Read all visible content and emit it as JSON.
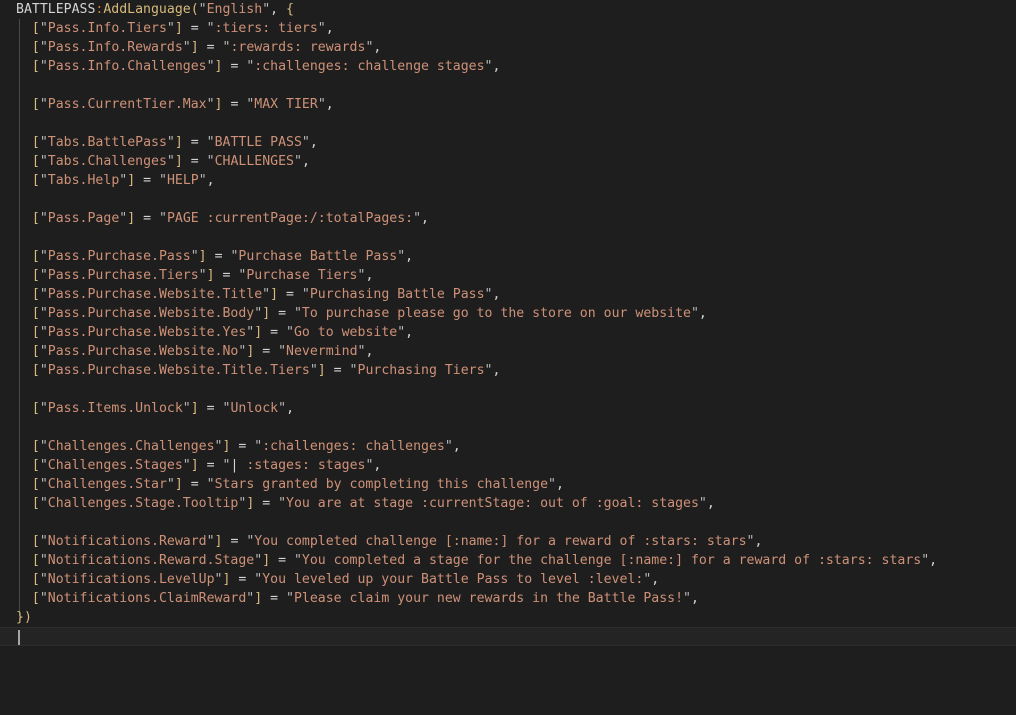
{
  "editor": {
    "kind": "code-editor",
    "language": "lua",
    "background_color": "#1e1e1e",
    "default_text_color": "#d4d4d4",
    "caret_color": "#a6a6a6",
    "current_line_background": "#242424",
    "indent_guide_color": "#4a4a4a",
    "palette": {
      "identifier": "#d4d4d4",
      "method_separator": "#cc7832",
      "function_name": "#d7ba7d",
      "bracket": "#d7ba7d",
      "quote": "#b9b9b9",
      "string": "#ce9178",
      "operator": "#d4d4d4",
      "punctuation": "#d4d4d4"
    }
  },
  "code": {
    "header": {
      "object": "BATTLEPASS",
      "separator": ":",
      "method": "AddLanguage",
      "open_paren": "(",
      "arg_quote": "\"",
      "arg": "English",
      "comma": ",",
      "open_brace": "{"
    },
    "footer": {
      "close": "})"
    },
    "caret_line_text": "",
    "groups": [
      {
        "name": "pass-info",
        "entries": [
          {
            "key": "Pass.Info.Tiers",
            "value": ":tiers: tiers"
          },
          {
            "key": "Pass.Info.Rewards",
            "value": ":rewards: rewards"
          },
          {
            "key": "Pass.Info.Challenges",
            "value": ":challenges: challenge stages"
          }
        ]
      },
      {
        "name": "current-tier",
        "entries": [
          {
            "key": "Pass.CurrentTier.Max",
            "value": "MAX TIER"
          }
        ]
      },
      {
        "name": "tabs",
        "entries": [
          {
            "key": "Tabs.BattlePass",
            "value": "BATTLE PASS"
          },
          {
            "key": "Tabs.Challenges",
            "value": "CHALLENGES"
          },
          {
            "key": "Tabs.Help",
            "value": "HELP"
          }
        ]
      },
      {
        "name": "page",
        "entries": [
          {
            "key": "Pass.Page",
            "value": "PAGE :currentPage:/:totalPages:"
          }
        ]
      },
      {
        "name": "purchase",
        "entries": [
          {
            "key": "Pass.Purchase.Pass",
            "value": "Purchase Battle Pass"
          },
          {
            "key": "Pass.Purchase.Tiers",
            "value": "Purchase Tiers"
          },
          {
            "key": "Pass.Purchase.Website.Title",
            "value": "Purchasing Battle Pass"
          },
          {
            "key": "Pass.Purchase.Website.Body",
            "value": "To purchase please go to the store on our website"
          },
          {
            "key": "Pass.Purchase.Website.Yes",
            "value": "Go to website"
          },
          {
            "key": "Pass.Purchase.Website.No",
            "value": "Nevermind"
          },
          {
            "key": "Pass.Purchase.Website.Title.Tiers",
            "value": "Purchasing Tiers"
          }
        ]
      },
      {
        "name": "items",
        "entries": [
          {
            "key": "Pass.Items.Unlock",
            "value": "Unlock"
          }
        ]
      },
      {
        "name": "challenges",
        "entries": [
          {
            "key": "Challenges.Challenges",
            "value": ":challenges: challenges"
          },
          {
            "key": "Challenges.Stages",
            "value": "| :stages: stages"
          },
          {
            "key": "Challenges.Star",
            "value": "Stars granted by completing this challenge"
          },
          {
            "key": "Challenges.Stage.Tooltip",
            "value": "You are at stage :currentStage: out of :goal: stages"
          }
        ]
      },
      {
        "name": "notifications",
        "entries": [
          {
            "key": "Notifications.Reward",
            "value": "You completed challenge [:name:] for a reward of :stars: stars"
          },
          {
            "key": "Notifications.Reward.Stage",
            "value": "You completed a stage for the challenge [:name:] for a reward of :stars: stars"
          },
          {
            "key": "Notifications.LevelUp",
            "value": "You leveled up your Battle Pass to level :level:"
          },
          {
            "key": "Notifications.ClaimReward",
            "value": "Please claim your new rewards in the Battle Pass!"
          }
        ]
      }
    ]
  }
}
